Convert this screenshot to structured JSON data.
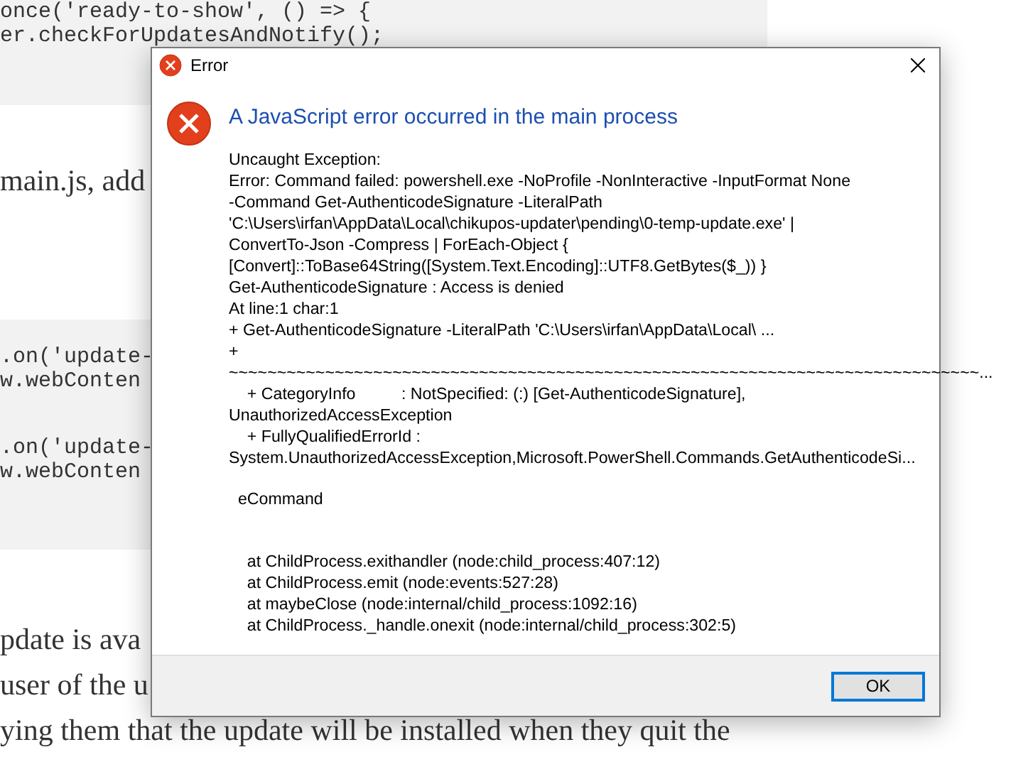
{
  "page": {
    "code_block_top": [
      "once('ready-to-show', () => {",
      "er.checkForUpdatesAndNotify();"
    ],
    "paragraph_1": "main.js, add",
    "code_block_middle": [
      [
        ".on('update-",
        "w.webConten"
      ],
      [
        ".on('update-",
        "w.webConten"
      ]
    ],
    "paragraph_2": [
      "pdate is ava",
      "user of the u",
      "ying them that the update will be installed when they quit the"
    ]
  },
  "dialog": {
    "title": "Error",
    "heading": "A JavaScript error occurred in the main process",
    "message_blocks": [
      [
        "Uncaught Exception:",
        "Error: Command failed: powershell.exe -NoProfile -NonInteractive -InputFormat None",
        "-Command Get-AuthenticodeSignature -LiteralPath",
        "'C:\\Users\\irfan\\AppData\\Local\\chikupos-updater\\pending\\0-temp-update.exe' |",
        "ConvertTo-Json -Compress | ForEach-Object {",
        "[Convert]::ToBase64String([System.Text.Encoding]::UTF8.GetBytes($_)) }",
        "Get-AuthenticodeSignature : Access is denied",
        "At line:1 char:1",
        "+ Get-AuthenticodeSignature -LiteralPath 'C:\\Users\\irfan\\AppData\\Local\\ ...",
        "+",
        "~~~~~~~~~~~~~~~~~~~~~~~~~~~~~~~~~~~~~~~~~~~~~~~~~~~~~~~~~~~~~~~~~~~~~~~~~~~~~~...",
        "    + CategoryInfo          : NotSpecified: (:) [Get-AuthenticodeSignature],",
        "UnauthorizedAccessException",
        "    + FullyQualifiedErrorId :",
        "System.UnauthorizedAccessException,Microsoft.PowerShell.Commands.GetAuthenticodeSi..."
      ],
      [
        "  eCommand"
      ],
      [
        "    at ChildProcess.exithandler (node:child_process:407:12)",
        "    at ChildProcess.emit (node:events:527:28)",
        "    at maybeClose (node:internal/child_process:1092:16)",
        "    at ChildProcess._handle.onexit (node:internal/child_process:302:5)"
      ]
    ],
    "buttons": [
      {
        "label": "OK",
        "selected": true
      }
    ]
  }
}
